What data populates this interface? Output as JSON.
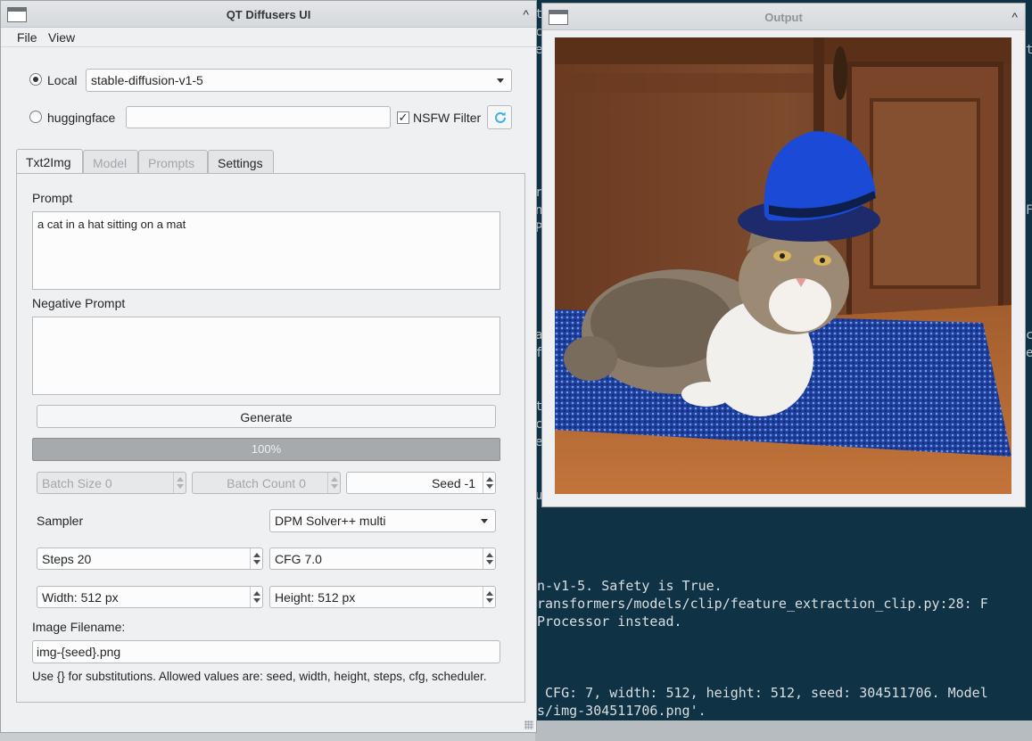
{
  "terminal": {
    "lines": [
      "n-v1-5. Safety is True.",
      "ransformers/models/clip/feature_extraction_clip.py:28: F",
      "Processor instead.",
      " CFG: 7, width: 512, height: 512, seed: 304511706. Model",
      "s/img-304511706.png'."
    ],
    "left_fragments": [
      "t",
      "c",
      "e",
      "r",
      "n",
      "P",
      "a",
      "f",
      "t",
      "c",
      "e",
      "u"
    ],
    "right_fragments": [
      "t",
      "e",
      "F",
      "c",
      "e"
    ]
  },
  "main_window": {
    "title": "QT Diffusers UI",
    "menu": {
      "file": "File",
      "view": "View"
    },
    "model_source": {
      "local_label": "Local",
      "local_selected": true,
      "local_model": "stable-diffusion-v1-5",
      "hf_label": "huggingface",
      "hf_value": "",
      "nsfw_label": "NSFW Filter",
      "nsfw_checked": true,
      "check_mark": "✓"
    },
    "tabs": [
      {
        "label": "Txt2Img",
        "active": true,
        "enabled": true
      },
      {
        "label": "Model",
        "active": false,
        "enabled": false
      },
      {
        "label": "Prompts",
        "active": false,
        "enabled": false
      },
      {
        "label": "Settings",
        "active": false,
        "enabled": true
      }
    ],
    "txt2img": {
      "prompt_label": "Prompt",
      "prompt_value": "a cat in a hat sitting on a mat",
      "negative_label": "Negative Prompt",
      "negative_value": "",
      "generate_label": "Generate",
      "progress_text": "100%",
      "progress_value": 1.0,
      "batch_size": "Batch Size 0",
      "batch_count": "Batch Count 0",
      "seed": "Seed -1",
      "sampler_label": "Sampler",
      "sampler_value": "DPM Solver++ multi",
      "steps": "Steps 20",
      "cfg": "CFG 7.0",
      "width": "Width: 512 px",
      "height": "Height: 512 px",
      "filename_label": "Image Filename:",
      "filename_value": "img-{seed}.png",
      "filename_help": "Use {} for substitutions. Allowed values are: seed, width, height, steps, cfg, scheduler."
    }
  },
  "output_window": {
    "title": "Output",
    "image_description": "cat-in-blue-top-hat-on-mat"
  },
  "colors": {
    "terminal_bg": "#0f3344",
    "window_bg": "#eff0f1",
    "accent": "#3daee9"
  }
}
